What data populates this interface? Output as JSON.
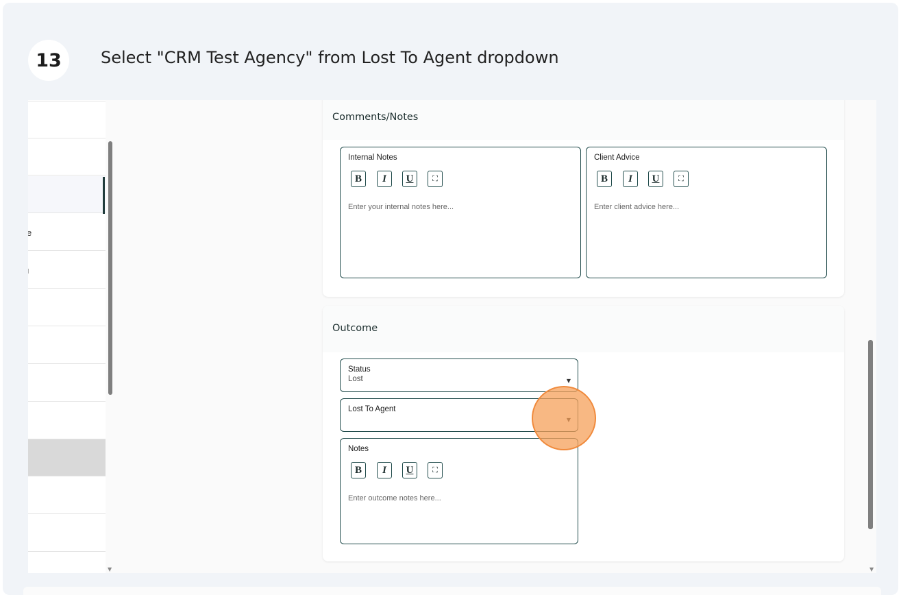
{
  "step": {
    "number": "13",
    "title": "Select \"CRM Test Agency\" from Lost To Agent dropdown"
  },
  "left_list": {
    "items": [
      {
        "text": ""
      },
      {
        "text": ""
      },
      {
        "text": ""
      },
      {
        "text": "e"
      },
      {
        "text": "ı"
      },
      {
        "text": ""
      },
      {
        "text": ""
      },
      {
        "text": ""
      },
      {
        "text": ""
      },
      {
        "text": ""
      },
      {
        "text": ""
      },
      {
        "text": ""
      }
    ]
  },
  "comments_card": {
    "title": "Comments/Notes",
    "internal_notes": {
      "label": "Internal Notes",
      "placeholder": "Enter your internal notes here..."
    },
    "client_advice": {
      "label": "Client Advice",
      "placeholder": "Enter client advice here..."
    }
  },
  "toolbar": {
    "bold": "B",
    "italic": "I",
    "underline": "U",
    "expand": "⛶"
  },
  "outcome_card": {
    "title": "Outcome",
    "status": {
      "label": "Status",
      "value": "Lost"
    },
    "lost_to_agent": {
      "label": "Lost To Agent",
      "value": ""
    },
    "notes": {
      "label": "Notes",
      "placeholder": "Enter outcome notes here..."
    }
  },
  "icons": {
    "caret": "▼",
    "scroll_down": "▼"
  },
  "colors": {
    "accent": "#1f4a4a",
    "highlight": "#f6a05a",
    "background": "#f1f4f8"
  }
}
